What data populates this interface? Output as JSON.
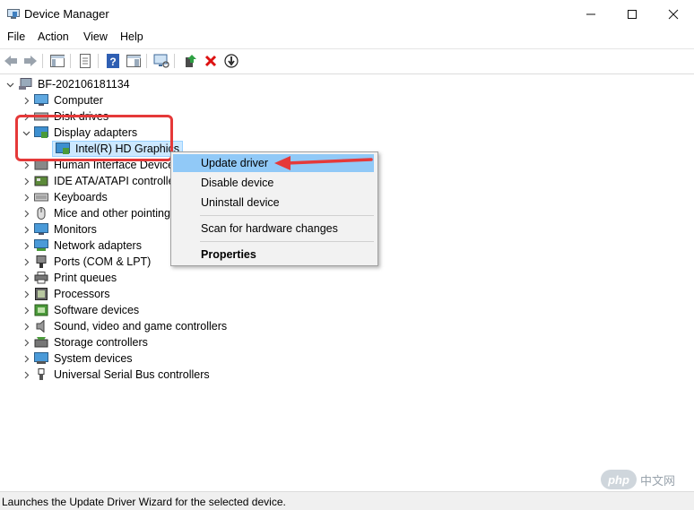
{
  "window": {
    "title": "Device Manager"
  },
  "menu": [
    "File",
    "Action",
    "View",
    "Help"
  ],
  "toolbar": {
    "icons": [
      "back-arrow-icon",
      "forward-arrow-icon",
      "show-hide-console-tree-icon",
      "properties-icon",
      "help-icon",
      "action-pane-icon",
      "scan-hardware-icon",
      "update-driver-icon",
      "uninstall-icon",
      "disable-device-icon"
    ]
  },
  "tree": {
    "root": "BF-202106181134",
    "items": [
      {
        "label": "Computer",
        "icon": "computer-icon"
      },
      {
        "label": "Disk drives",
        "icon": "disk-drive-icon"
      },
      {
        "label": "Display adapters",
        "icon": "display-adapter-icon",
        "expanded": true
      },
      {
        "label": "Intel(R) HD Graphics",
        "icon": "display-adapter-icon",
        "child": true,
        "selected": true
      },
      {
        "label": "Human Interface Device",
        "icon": "hid-icon"
      },
      {
        "label": "IDE ATA/ATAPI controller",
        "icon": "ide-controller-icon"
      },
      {
        "label": "Keyboards",
        "icon": "keyboard-icon"
      },
      {
        "label": "Mice and other pointing",
        "icon": "mouse-icon"
      },
      {
        "label": "Monitors",
        "icon": "monitor-icon"
      },
      {
        "label": "Network adapters",
        "icon": "network-adapter-icon"
      },
      {
        "label": "Ports (COM & LPT)",
        "icon": "port-icon"
      },
      {
        "label": "Print queues",
        "icon": "printer-icon"
      },
      {
        "label": "Processors",
        "icon": "processor-icon"
      },
      {
        "label": "Software devices",
        "icon": "software-device-icon"
      },
      {
        "label": "Sound, video and game controllers",
        "icon": "speaker-icon"
      },
      {
        "label": "Storage controllers",
        "icon": "storage-controller-icon"
      },
      {
        "label": "System devices",
        "icon": "system-device-icon"
      },
      {
        "label": "Universal Serial Bus controllers",
        "icon": "usb-icon"
      }
    ]
  },
  "context_menu": {
    "items": [
      "Update driver",
      "Disable device",
      "Uninstall device",
      "Scan for hardware changes",
      "Properties"
    ],
    "highlighted": "Update driver"
  },
  "status": {
    "text": "Launches the Update Driver Wizard for the selected device."
  },
  "watermark": {
    "logo": "php",
    "text": "中文网"
  },
  "colors": {
    "annotation": "#e53939",
    "highlight": "#91c9f7",
    "selection": "#cce8ff"
  }
}
